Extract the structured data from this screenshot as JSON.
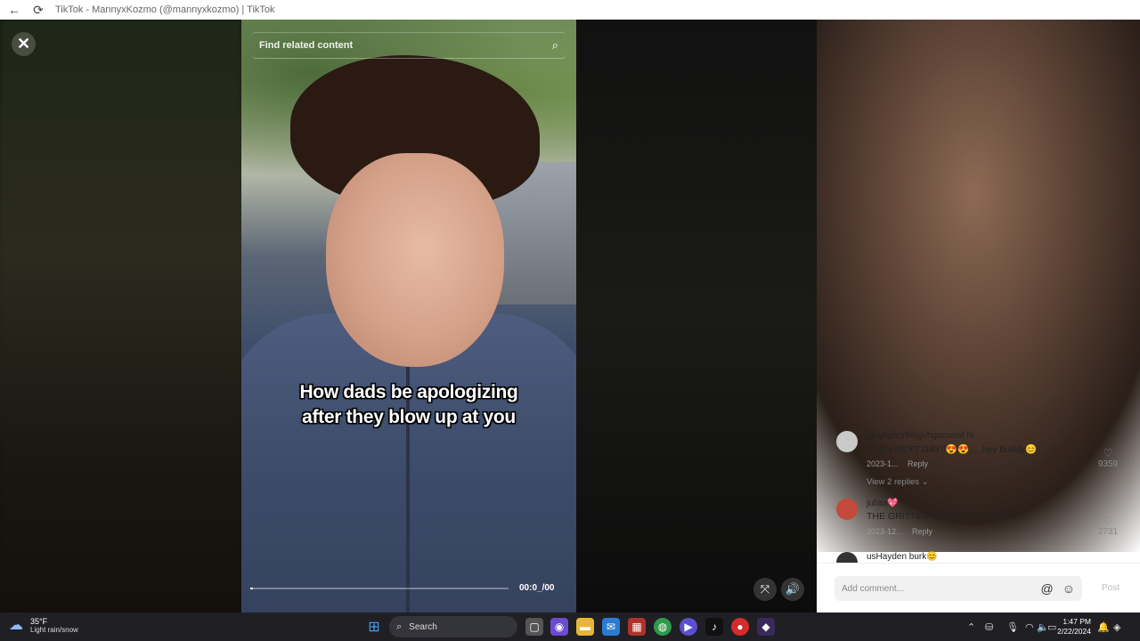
{
  "window": {
    "title": "TikTok - MannyxKozmo (@mannyxkozmo) | TikTok",
    "back_icon": "arrow-left-icon",
    "reload_icon": "reload-icon"
  },
  "video": {
    "search_placeholder": "Find related content",
    "caption_line1": "How dads be apologizing",
    "caption_line2": "after they blow up at you",
    "timecode": "00:0_/00",
    "progress_fraction": 0.0
  },
  "controls": {
    "close_label": "✕",
    "mute_label": "🔊",
    "float_label": "⤧"
  },
  "comments": [
    {
      "user": "jgcgbgbcrfhhgvhgccssrsl ht",
      "text": "THEN NEXT DAY!!😍😍.....hey buddy😊",
      "date": "2023-1...",
      "reply": "Reply",
      "likes": "9359"
    },
    {
      "user": "juliaa💖",
      "text": "THE GRITTED TEETH IS SO REAL",
      "date": "2023-12...",
      "reply": "Reply",
      "likes": "2731"
    },
    {
      "user": "usHayden burk😊",
      "text": "",
      "date": "",
      "reply": "",
      "likes": ""
    }
  ],
  "view_replies": "View 2 replies ⌄",
  "add_comment": {
    "placeholder": "Add comment...",
    "post_label": "Post",
    "mention_icon": "@",
    "emoji_icon": "☺"
  },
  "taskbar": {
    "temperature": "35°F",
    "condition": "Light rain/snow",
    "search_label": "Search",
    "time": "1:47 PM",
    "date": "2/22/2024"
  }
}
